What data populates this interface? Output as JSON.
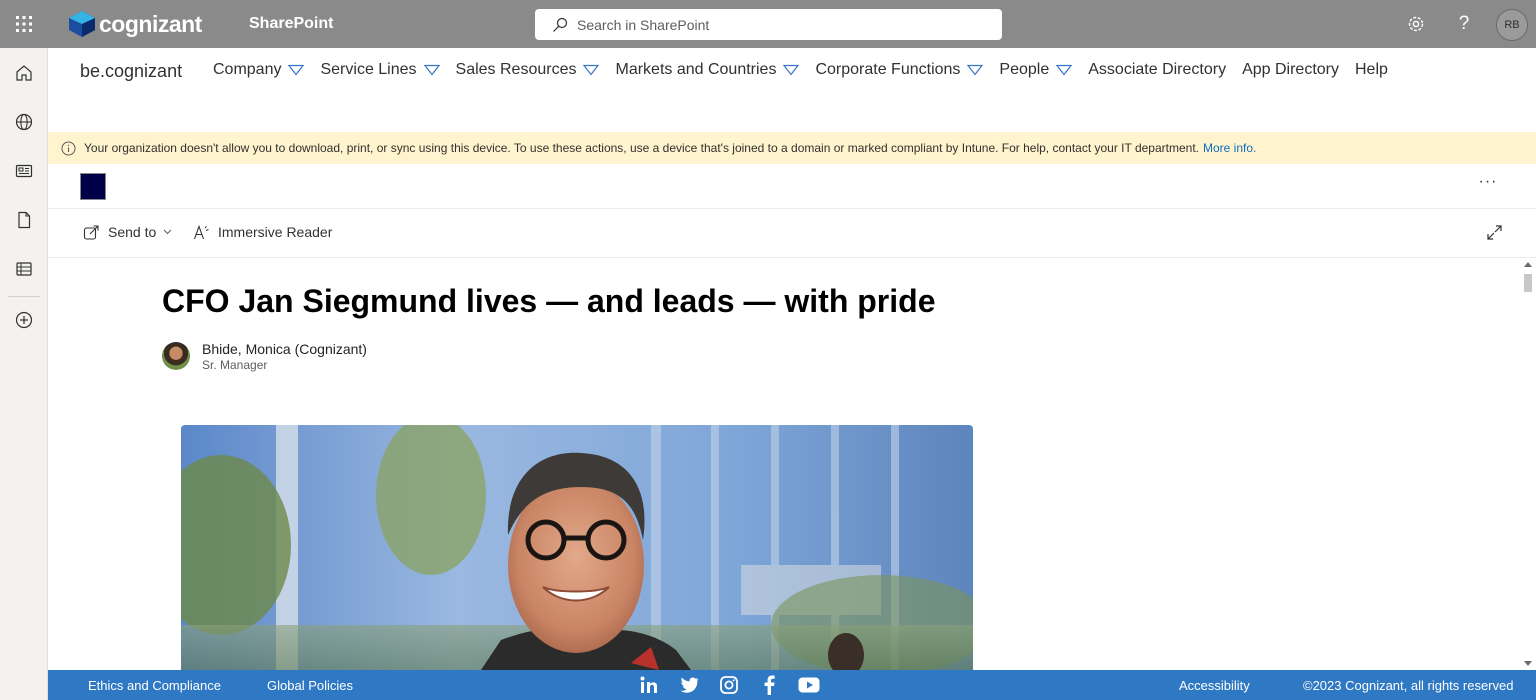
{
  "header": {
    "brand": "cognizant",
    "app_name": "SharePoint",
    "search_placeholder": "Search in SharePoint",
    "user_initials": "RB"
  },
  "site_nav": {
    "site_title": "be.cognizant",
    "items": [
      {
        "label": "Company",
        "has_dropdown": true
      },
      {
        "label": "Service Lines",
        "has_dropdown": true
      },
      {
        "label": "Sales Resources",
        "has_dropdown": true
      },
      {
        "label": "Markets and Countries",
        "has_dropdown": true
      },
      {
        "label": "Corporate Functions",
        "has_dropdown": true
      },
      {
        "label": "People",
        "has_dropdown": true
      },
      {
        "label": "Associate Directory",
        "has_dropdown": false
      },
      {
        "label": "App Directory",
        "has_dropdown": false
      },
      {
        "label": "Help",
        "has_dropdown": false
      }
    ]
  },
  "message_bar": {
    "text": "Your organization doesn't allow you to download, print, or sync using this device. To use these actions, use a device that's joined to a domain or marked compliant by Intune. For help, contact your IT department.",
    "link": "More info."
  },
  "page_header": {
    "more_label": "···"
  },
  "command_bar": {
    "send_to": "Send to",
    "immersive_reader": "Immersive Reader"
  },
  "article": {
    "title": "CFO Jan Siegmund lives — and leads — with pride",
    "author_name": "Bhide, Monica (Cognizant)",
    "author_role": "Sr. Manager"
  },
  "footer": {
    "ethics": "Ethics and Compliance",
    "policies": "Global Policies",
    "accessibility": "Accessibility",
    "copyright": "©2023 Cognizant, all rights reserved",
    "socials": [
      "linkedin-icon",
      "twitter-icon",
      "instagram-icon",
      "facebook-icon",
      "youtube-icon"
    ]
  },
  "colors": {
    "suite_bar": "#8a8a8a",
    "message_bar": "#fff4ce",
    "footer": "#2f78c4",
    "site_logo": "#000048",
    "link": "#0f6cbd"
  }
}
